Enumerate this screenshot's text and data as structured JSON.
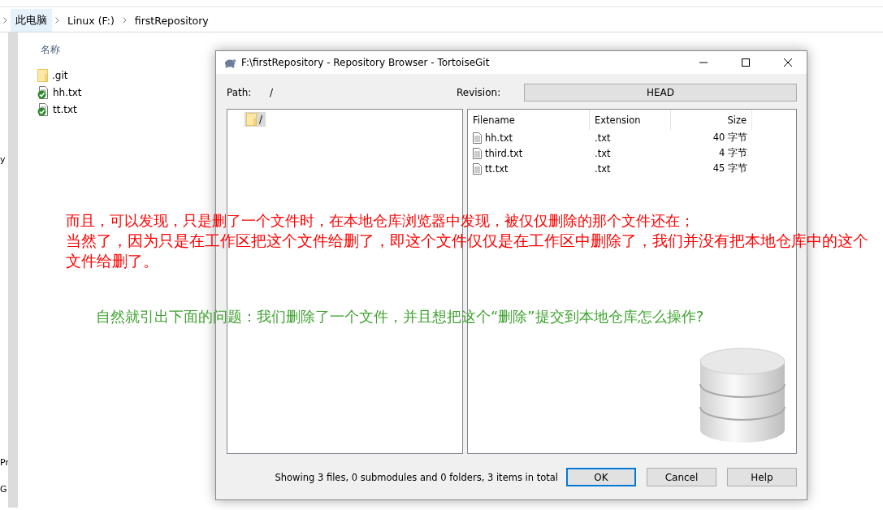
{
  "explorer": {
    "breadcrumb": [
      "此电脑",
      "Linux (F:)",
      "firstRepository"
    ],
    "columns": [
      "名称"
    ],
    "files": [
      {
        "name": ".git",
        "kind": "folder"
      },
      {
        "name": "hh.txt",
        "kind": "tracked"
      },
      {
        "name": "tt.txt",
        "kind": "tracked"
      }
    ],
    "nav_fragments": [
      "y",
      "Pr",
      "G"
    ]
  },
  "dialog": {
    "title": "F:\\firstRepository - Repository Browser - TortoiseGit",
    "path_label": "Path:",
    "path": "/",
    "revision_label": "Revision:",
    "revision": "HEAD",
    "tree": [
      {
        "name": "/",
        "selected": true
      }
    ],
    "columns": [
      "Filename",
      "Extension",
      "Size"
    ],
    "rows": [
      {
        "filename": "hh.txt",
        "extension": ".txt",
        "size": "40 字节"
      },
      {
        "filename": "third.txt",
        "extension": ".txt",
        "size": "4 字节"
      },
      {
        "filename": "tt.txt",
        "extension": ".txt",
        "size": "45 字节"
      }
    ],
    "status": "Showing 3 files, 0 submodules and 0 folders, 3 items in total",
    "buttons": [
      {
        "label": "OK",
        "default": true
      },
      {
        "label": "Cancel",
        "default": false
      },
      {
        "label": "Help",
        "default": false
      }
    ]
  },
  "annotations": [
    {
      "text": "而且，可以发现，只是删了一个文件时，在本地仓库浏览器中发现，被仅仅删除的那个文件还在；",
      "color": "#ff0000"
    },
    {
      "text": "当然了，因为只是在工作区把这个文件给删了，即这个文件仅仅是在工作区中删除了，我们并没有把本地仓库中的这个文件给删了。",
      "color": "#ff0000"
    },
    {
      "text": "自然就引出下面的问题：我们删除了一个文件，并且想把这个“删除”提交到本地仓库怎么操作?",
      "color": "#3ea22f"
    }
  ]
}
